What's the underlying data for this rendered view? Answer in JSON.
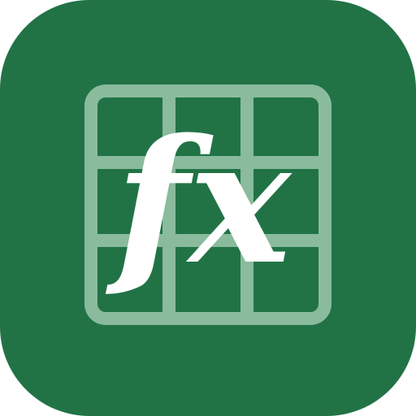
{
  "icon": {
    "name": "spreadsheet-formula-app-icon",
    "background_color": "#217346",
    "grid_color": "#9cc8ab",
    "glyph_color": "#ffffff",
    "glyph_text": "fx",
    "glyph_icon": "function-fx-icon",
    "grid_icon": "spreadsheet-grid-icon"
  }
}
